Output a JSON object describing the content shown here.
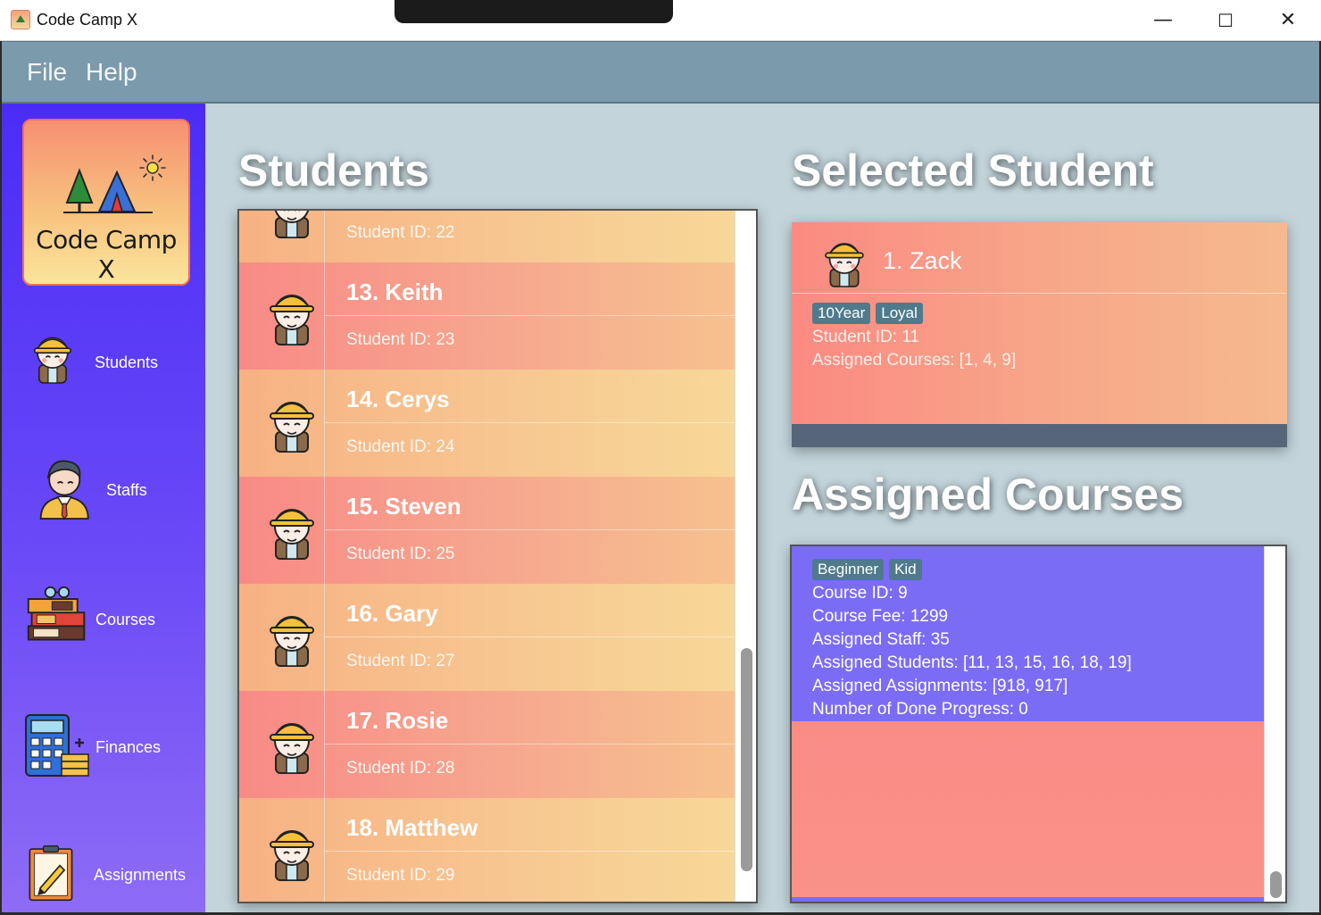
{
  "window": {
    "title": "Code Camp X",
    "minimize": "—",
    "maximize": "☐",
    "close": "✕"
  },
  "menu": [
    {
      "label": "File"
    },
    {
      "label": "Help"
    }
  ],
  "logo": {
    "text": "Code Camp X"
  },
  "nav": [
    {
      "label": "Students",
      "icon": "student-icon"
    },
    {
      "label": "Staffs",
      "icon": "staff-icon"
    },
    {
      "label": "Courses",
      "icon": "books-icon"
    },
    {
      "label": "Finances",
      "icon": "calculator-icon"
    },
    {
      "label": "Assignments",
      "icon": "clipboard-icon"
    }
  ],
  "students_panel": {
    "title": "Students",
    "scroll_position": 0.95,
    "rows": [
      {
        "name": "",
        "id_text": "Student ID: 22"
      },
      {
        "name": "13. Keith",
        "id_text": "Student ID: 23"
      },
      {
        "name": "14. Cerys",
        "id_text": "Student ID: 24"
      },
      {
        "name": "15. Steven",
        "id_text": "Student ID: 25"
      },
      {
        "name": "16. Gary",
        "id_text": "Student ID: 27"
      },
      {
        "name": "17. Rosie",
        "id_text": "Student ID: 28"
      },
      {
        "name": "18. Matthew",
        "id_text": "Student ID: 29"
      }
    ]
  },
  "selected_student": {
    "title": "Selected Student",
    "name": "1.  Zack",
    "tags": [
      "10Year",
      "Loyal"
    ],
    "student_id": "Student ID: 11",
    "assigned_courses": "Assigned Courses: [1, 4, 9]"
  },
  "assigned_courses": {
    "title": "Assigned Courses",
    "tags": [
      "Beginner",
      "Kid"
    ],
    "course_id": "Course ID: 9",
    "course_fee": "Course Fee: 1299",
    "assigned_staff": "Assigned Staff: 35",
    "assigned_students": "Assigned Students: [11, 13, 15, 16, 18, 19]",
    "assigned_assignments": "Assigned Assignments: [918, 917]",
    "done_progress": "Number of Done Progress: 0"
  },
  "colors": {
    "sidebar_top": "#4a2cf6",
    "menubar": "#7b9aab",
    "main_bg": "#c3d5db",
    "course_card": "#7b6cf6",
    "tag": "#4f7a8c"
  }
}
